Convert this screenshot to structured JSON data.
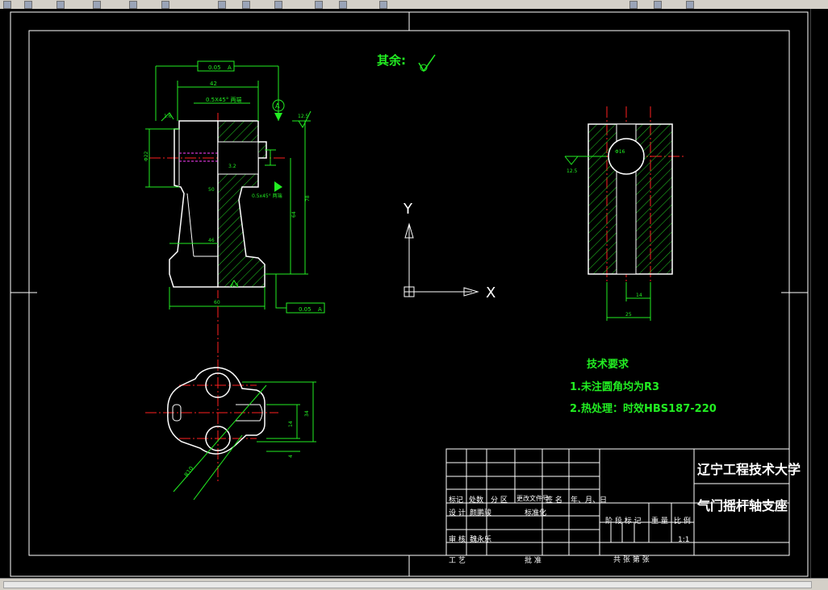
{
  "drawing": {
    "surface_finish_note": "其余:",
    "tech_requirements": {
      "title": "技术要求",
      "items": [
        "1.未注圆角均为R3",
        "2.热处理：时效HBS187-220"
      ]
    },
    "ucs": {
      "y_label": "Y",
      "x_label": "X"
    },
    "front_view": {
      "tolerance_top": "0.05",
      "tolerance_top_datum": "A",
      "width_dim": "42",
      "chamfer_note": "0.5X45° 两端",
      "datum_label": "A",
      "roughness_top": "12.5",
      "roughness_left": "1.6",
      "roughness_mid": "3.2",
      "dia_left": "Φ22",
      "dim_inner_50": "50",
      "dim_46": "46",
      "dim_60": "60",
      "dim_vert_78": "78",
      "dim_vert_64": "64",
      "chamfer_note2": "0.5x45° 两端",
      "roughness_bottom": "6.3",
      "tolerance_bottom": "0.05",
      "tolerance_bottom_datum": "A"
    },
    "side_view": {
      "roughness": "12.5",
      "dim_14": "14",
      "dim_25": "25",
      "dia_label": "Φ16"
    },
    "plan_view": {
      "dim_34": "34",
      "dim_14": "14",
      "dim_4": "4",
      "radius_note": "R10"
    }
  },
  "title_block": {
    "school": "辽宁工程技术大学",
    "part_name": "气门摇杆轴支座",
    "rev_headers": [
      "标记",
      "处数",
      "分 区",
      "更改文件号",
      "签 名",
      "年、月、日"
    ],
    "design_label": "设 计",
    "designer": "颜鹏骏",
    "standard_label": "标准化",
    "review_label": "审 核",
    "reviewer": "魏永乐",
    "process_label": "工 艺",
    "approve_label": "批 准",
    "stage_label": "阶 段 标 记",
    "weight_label": "重 量",
    "scale_label": "比 例",
    "scale_value": "1:1",
    "sheets_label": "共   张 第   张"
  }
}
